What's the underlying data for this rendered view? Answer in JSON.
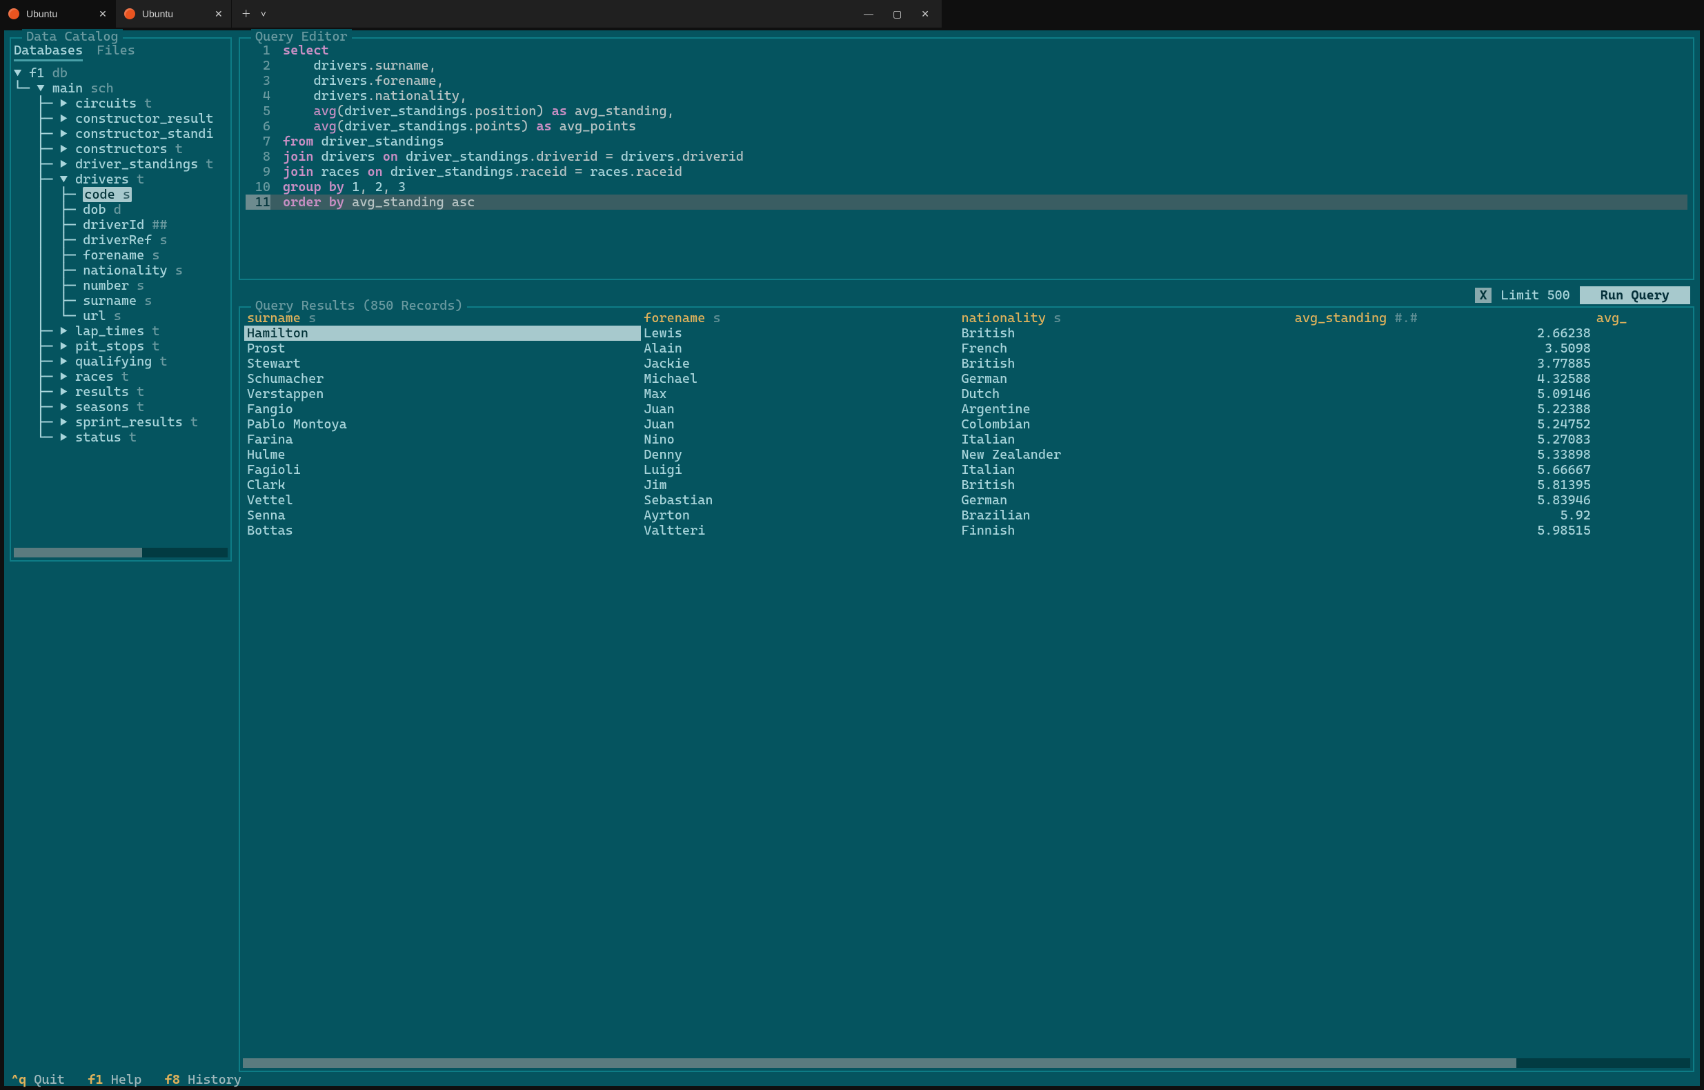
{
  "window": {
    "tabs": [
      {
        "label": "Ubuntu",
        "active": true
      },
      {
        "label": "Ubuntu",
        "active": false
      }
    ]
  },
  "catalog": {
    "title": "Data Catalog",
    "tabs": {
      "databases": "Databases",
      "files": "Files"
    },
    "tree": {
      "db": {
        "name": "f1",
        "type": "db"
      },
      "schema": {
        "name": "main",
        "type": "sch"
      },
      "tables": [
        {
          "name": "circuits",
          "type": "t",
          "expanded": false
        },
        {
          "name": "constructor_result",
          "type": "",
          "expanded": false
        },
        {
          "name": "constructor_standi",
          "type": "",
          "expanded": false
        },
        {
          "name": "constructors",
          "type": "t",
          "expanded": false
        },
        {
          "name": "driver_standings",
          "type": "t",
          "expanded": false
        },
        {
          "name": "drivers",
          "type": "t",
          "expanded": true,
          "columns": [
            {
              "name": "code",
              "type": "s",
              "selected": true
            },
            {
              "name": "dob",
              "type": "d"
            },
            {
              "name": "driverId",
              "type": "##"
            },
            {
              "name": "driverRef",
              "type": "s"
            },
            {
              "name": "forename",
              "type": "s"
            },
            {
              "name": "nationality",
              "type": "s"
            },
            {
              "name": "number",
              "type": "s"
            },
            {
              "name": "surname",
              "type": "s"
            },
            {
              "name": "url",
              "type": "s"
            }
          ]
        },
        {
          "name": "lap_times",
          "type": "t",
          "expanded": false
        },
        {
          "name": "pit_stops",
          "type": "t",
          "expanded": false
        },
        {
          "name": "qualifying",
          "type": "t",
          "expanded": false
        },
        {
          "name": "races",
          "type": "t",
          "expanded": false
        },
        {
          "name": "results",
          "type": "t",
          "expanded": false
        },
        {
          "name": "seasons",
          "type": "t",
          "expanded": false
        },
        {
          "name": "sprint_results",
          "type": "t",
          "expanded": false
        },
        {
          "name": "status",
          "type": "t",
          "expanded": false
        }
      ]
    }
  },
  "editor": {
    "title": "Query Editor",
    "lines": [
      {
        "n": 1,
        "html": "<span class='kw'>select</span>"
      },
      {
        "n": 2,
        "html": "    <span class='ident'>drivers</span>.surname,"
      },
      {
        "n": 3,
        "html": "    <span class='ident'>drivers</span>.forename,"
      },
      {
        "n": 4,
        "html": "    <span class='ident'>drivers</span>.nationality,"
      },
      {
        "n": 5,
        "html": "    <span class='kw2'>avg</span>(<span class='ident'>driver_standings</span>.position) <span class='kw'>as</span> avg_standing,"
      },
      {
        "n": 6,
        "html": "    <span class='kw2'>avg</span>(<span class='ident'>driver_standings</span>.points) <span class='kw'>as</span> avg_points"
      },
      {
        "n": 7,
        "html": "<span class='kw'>from</span> <span class='ident'>driver_standings</span>"
      },
      {
        "n": 8,
        "html": "<span class='kw'>join</span> <span class='ident'>drivers</span> <span class='kw'>on</span> <span class='ident'>driver_standings</span>.driverid = <span class='ident'>drivers</span>.driverid"
      },
      {
        "n": 9,
        "html": "<span class='kw'>join</span> <span class='ident'>races</span> <span class='kw'>on</span> <span class='ident'>driver_standings</span>.raceid = <span class='ident'>races</span>.raceid"
      },
      {
        "n": 10,
        "html": "<span class='kw'>group by</span> <span class='num'>1</span>, <span class='num'>2</span>, <span class='num'>3</span>"
      },
      {
        "n": 11,
        "html": "<span class='kw'>order by</span> avg_standing asc",
        "current": true
      }
    ]
  },
  "runbar": {
    "checkbox": "X",
    "limit": "Limit 500",
    "run": "Run Query"
  },
  "results": {
    "title": "Query Results (850 Records)",
    "columns": [
      {
        "name": "surname",
        "type": "s"
      },
      {
        "name": "forename",
        "type": "s"
      },
      {
        "name": "nationality",
        "type": "s"
      },
      {
        "name": "avg_standing",
        "type": "#.#"
      },
      {
        "name": "avg_",
        "type": ""
      }
    ],
    "rows": [
      {
        "surname": "Hamilton",
        "forename": "Lewis",
        "nationality": "British",
        "avg_standing": "2.66238",
        "sel": true
      },
      {
        "surname": "Prost",
        "forename": "Alain",
        "nationality": "French",
        "avg_standing": "3.5098"
      },
      {
        "surname": "Stewart",
        "forename": "Jackie",
        "nationality": "British",
        "avg_standing": "3.77885"
      },
      {
        "surname": "Schumacher",
        "forename": "Michael",
        "nationality": "German",
        "avg_standing": "4.32588"
      },
      {
        "surname": "Verstappen",
        "forename": "Max",
        "nationality": "Dutch",
        "avg_standing": "5.09146"
      },
      {
        "surname": "Fangio",
        "forename": "Juan",
        "nationality": "Argentine",
        "avg_standing": "5.22388"
      },
      {
        "surname": "Pablo Montoya",
        "forename": "Juan",
        "nationality": "Colombian",
        "avg_standing": "5.24752"
      },
      {
        "surname": "Farina",
        "forename": "Nino",
        "nationality": "Italian",
        "avg_standing": "5.27083"
      },
      {
        "surname": "Hulme",
        "forename": "Denny",
        "nationality": "New Zealander",
        "avg_standing": "5.33898"
      },
      {
        "surname": "Fagioli",
        "forename": "Luigi",
        "nationality": "Italian",
        "avg_standing": "5.66667"
      },
      {
        "surname": "Clark",
        "forename": "Jim",
        "nationality": "British",
        "avg_standing": "5.81395"
      },
      {
        "surname": "Vettel",
        "forename": "Sebastian",
        "nationality": "German",
        "avg_standing": "5.83946"
      },
      {
        "surname": "Senna",
        "forename": "Ayrton",
        "nationality": "Brazilian",
        "avg_standing": "5.92"
      },
      {
        "surname": "Bottas",
        "forename": "Valtteri",
        "nationality": "Finnish",
        "avg_standing": "5.98515"
      }
    ]
  },
  "footer": {
    "q": "^q",
    "quit": "Quit",
    "f1": "f1",
    "help": "Help",
    "f8": "f8",
    "history": "History"
  }
}
